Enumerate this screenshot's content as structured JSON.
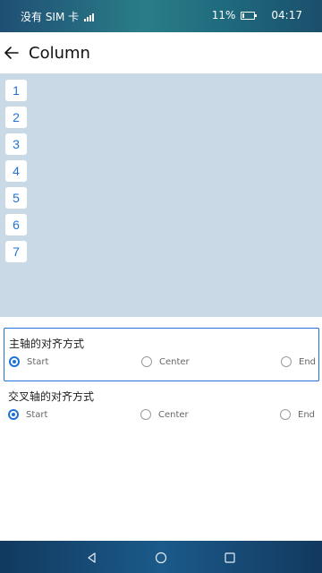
{
  "status_bar": {
    "carrier": "没有 SIM 卡",
    "battery": "11%",
    "time": "04:17"
  },
  "app_bar": {
    "title": "Column",
    "back_icon": "arrow-left-icon"
  },
  "preview": {
    "background": "#c9dae6",
    "items": [
      "1",
      "2",
      "3",
      "4",
      "5",
      "6",
      "7"
    ]
  },
  "groups": [
    {
      "title": "主轴的对齐方式",
      "options": [
        "Start",
        "Center",
        "End"
      ],
      "selected": "Start"
    },
    {
      "title": "交叉轴的对齐方式",
      "options": [
        "Start",
        "Center",
        "End"
      ],
      "selected": "Start"
    }
  ],
  "colors": {
    "accent": "#1f72d4"
  },
  "nav_bar": {
    "icons": [
      "back-triangle-icon",
      "home-circle-icon",
      "recents-square-icon"
    ]
  }
}
